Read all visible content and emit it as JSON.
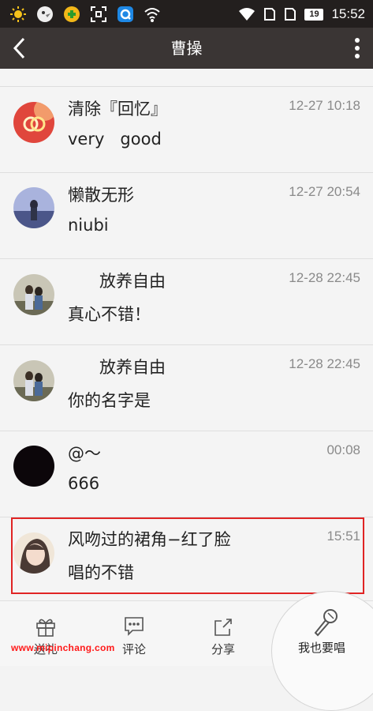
{
  "status_bar": {
    "icons": [
      "sun-icon",
      "bird-app-icon",
      "game-app-icon",
      "scan-icon",
      "browser-icon",
      "wifi-icon"
    ],
    "right_icons": [
      "wifi-icon",
      "sim-card-icon",
      "sim-card-icon"
    ],
    "battery": "19",
    "time": "15:52"
  },
  "header": {
    "title": "曹操",
    "back_icon": "chevron-left-icon",
    "more_icon": "more-vertical-icon"
  },
  "comments": [
    {
      "name": "清除『回忆』",
      "time": "12-27 10:18",
      "message": "very   good",
      "avatar": "rings-avatar"
    },
    {
      "name": "懒散无形",
      "time": "12-27 20:54",
      "message": "niubi",
      "avatar": "landscape-avatar"
    },
    {
      "name": "      放养自由",
      "time": "12-28 22:45",
      "message": "真心不错！",
      "avatar": "couple-avatar"
    },
    {
      "name": "      放养自由",
      "time": "12-28 22:45",
      "message": "你的名字是",
      "avatar": "couple-avatar"
    },
    {
      "name": "@～",
      "time": "00:08",
      "message": "666",
      "avatar": "dark-avatar"
    },
    {
      "name": "风吻过的裙角−红了脸",
      "time": "15:51",
      "message": "唱的不错",
      "avatar": "girl-avatar"
    }
  ],
  "bottom_bar": {
    "gift_label": "送礼",
    "comment_label": "评论",
    "share_label": "分享",
    "sing_label": "我也要唱"
  },
  "watermark": "www.mipinchang.com",
  "colors": {
    "status_bar": "#231f1e",
    "title_bar": "#3a3534",
    "highlight": "#e02424",
    "watermark": "#ff1a1a"
  }
}
